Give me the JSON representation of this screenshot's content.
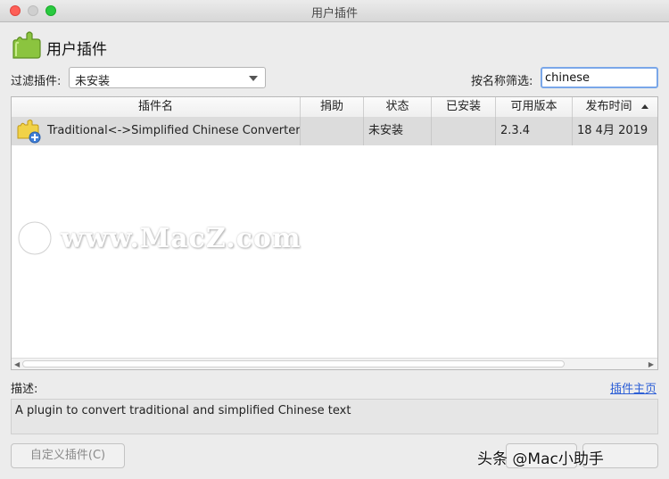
{
  "window": {
    "title": "用户插件"
  },
  "header": {
    "title": "用户插件",
    "icon": "puzzle-plugin-icon"
  },
  "filter": {
    "label": "过滤插件:",
    "selected": "未安装"
  },
  "name_filter": {
    "label": "按名称筛选:",
    "value": "chinese"
  },
  "table": {
    "columns": [
      "插件名",
      "捐助",
      "状态",
      "已安装",
      "可用版本",
      "发布时间"
    ],
    "sorted_column": "发布时间",
    "rows": [
      {
        "name": "Traditional<->Simplified Chinese Converter",
        "donate": "",
        "status": "未安装",
        "installed": "",
        "available_version": "2.3.4",
        "released": "18 4月 2019"
      }
    ]
  },
  "watermark": {
    "text": "www.MacZ.com"
  },
  "description": {
    "label": "描述:",
    "homepage_link": "插件主页",
    "text": "A plugin to convert traditional and simplified Chinese text"
  },
  "buttons": {
    "custom_plugin": "自定义插件(C)"
  },
  "overlay": {
    "text": "头条 @Mac小助手"
  },
  "colors": {
    "accent": "#7aa7e9",
    "link": "#2d5fd6",
    "selected_row": "#dcdcdc"
  }
}
